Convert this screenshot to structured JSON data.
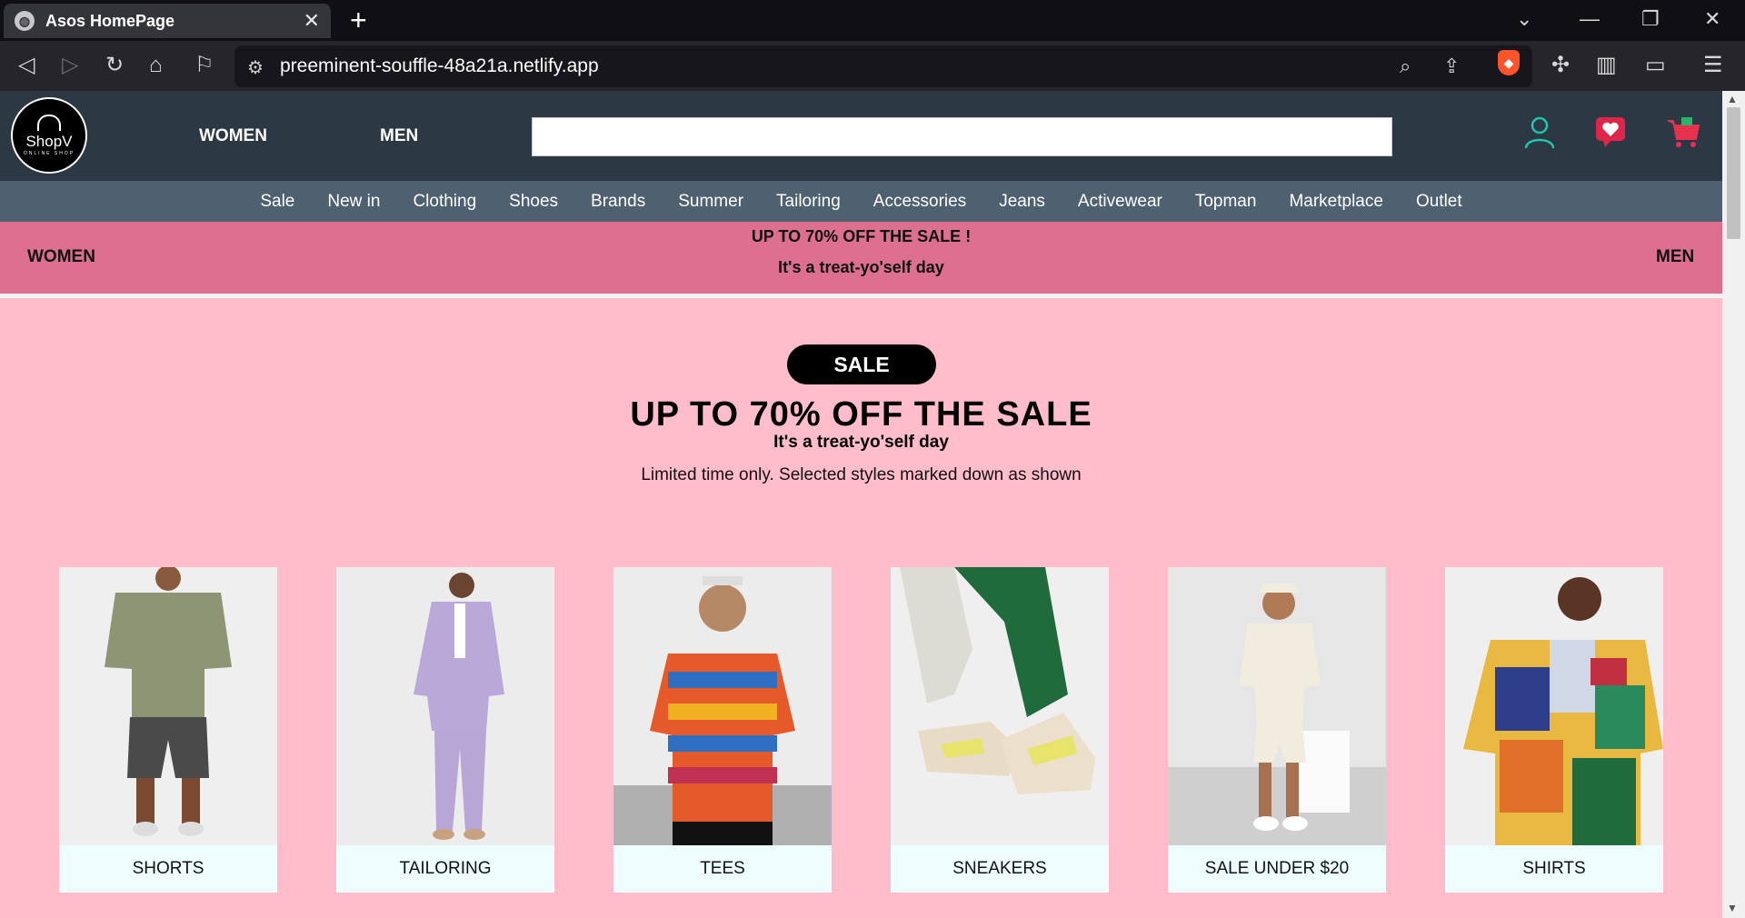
{
  "browser": {
    "tab_title": "Asos HomePage",
    "tab_close": "✕",
    "new_tab": "+",
    "url": "preeminent-souffle-48a21a.netlify.app"
  },
  "header": {
    "logo_name": "ShopV",
    "logo_sub": "ONLINE SHOP",
    "women": "WOMEN",
    "men": "MEN",
    "search_value": ""
  },
  "categories": [
    "Sale",
    "New in",
    "Clothing",
    "Shoes",
    "Brands",
    "Summer",
    "Tailoring",
    "Accessories",
    "Jeans",
    "Activewear",
    "Topman",
    "Marketplace",
    "Outlet"
  ],
  "promo": {
    "left": "WOMEN",
    "right": "MEN",
    "line1": "UP TO 70% OFF THE SALE !",
    "line2": "It's a treat-yo'self day"
  },
  "hero": {
    "pill": "SALE",
    "title": "UP TO 70% OFF THE SALE",
    "subtitle": "It's a treat-yo'self day",
    "note": "Limited time only. Selected styles marked down as shown"
  },
  "cards": [
    {
      "label": "SHORTS"
    },
    {
      "label": "TAILORING"
    },
    {
      "label": "TEES"
    },
    {
      "label": "SNEAKERS"
    },
    {
      "label": "SALE UNDER $20"
    },
    {
      "label": "SHIRTS"
    }
  ],
  "colors": {
    "header_bg": "#2c3844",
    "nav_bg": "#4f6071",
    "promo_bg": "#dc708e",
    "page_bg": "#ffbccb",
    "caption_bg": "#eefefe"
  }
}
